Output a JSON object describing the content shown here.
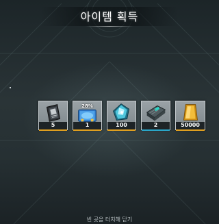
{
  "title": "아이템 획득",
  "footer_hint": "빈 곳을 터치해 닫기",
  "items": [
    {
      "name": "document-card-icon",
      "count": "5",
      "rarity_color": "#e0a020"
    },
    {
      "name": "blue-crate-icon",
      "badge": "28%",
      "count": "1",
      "rarity_color": "#e0a020"
    },
    {
      "name": "crystal-core-icon",
      "count": "100",
      "rarity_color": "#e0a020"
    },
    {
      "name": "ammo-module-icon",
      "count": "2",
      "rarity_color": "#2aa7c9"
    },
    {
      "name": "gold-bar-icon",
      "count": "50000",
      "rarity_color": "#e0a020"
    }
  ]
}
